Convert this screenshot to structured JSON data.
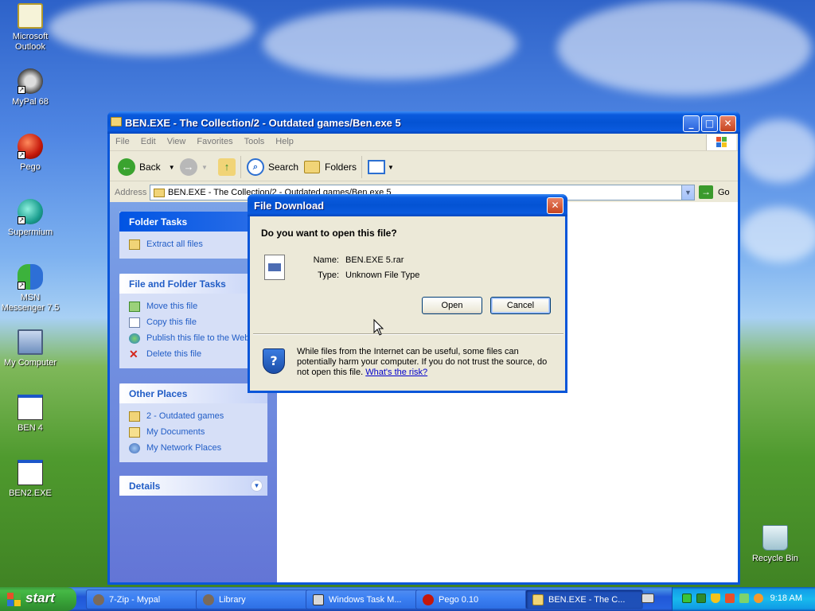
{
  "desktop": {
    "icons": [
      {
        "label": "Microsoft Outlook"
      },
      {
        "label": "MyPal 68"
      },
      {
        "label": "Pego"
      },
      {
        "label": "Supermium"
      },
      {
        "label": "MSN Messenger 7.5"
      },
      {
        "label": "My Computer"
      },
      {
        "label": "BEN 4"
      },
      {
        "label": "BEN2.EXE"
      },
      {
        "label": "Recycle Bin"
      }
    ]
  },
  "explorer": {
    "title": "BEN.EXE - The Collection/2 - Outdated games/Ben.exe 5",
    "menu": [
      "File",
      "Edit",
      "View",
      "Favorites",
      "Tools",
      "Help"
    ],
    "toolbar": {
      "back": "Back",
      "search": "Search",
      "folders": "Folders"
    },
    "address": {
      "label": "Address",
      "value": "BEN.EXE - The Collection/2 - Outdated games/Ben.exe 5",
      "go": "Go"
    },
    "folder_tasks": {
      "title": "Folder Tasks",
      "items": [
        "Extract all files"
      ]
    },
    "file_tasks": {
      "title": "File and Folder Tasks",
      "items": [
        "Move this file",
        "Copy this file",
        "Publish this file to the Web",
        "Delete this file"
      ]
    },
    "other_places": {
      "title": "Other Places",
      "items": [
        "2 - Outdated games",
        "My Documents",
        "My Network Places"
      ]
    },
    "details": {
      "title": "Details"
    }
  },
  "dialog": {
    "title": "File Download",
    "question": "Do you want to open this file?",
    "name_label": "Name:",
    "name_value": "BEN.EXE 5.rar",
    "type_label": "Type:",
    "type_value": "Unknown File Type",
    "open": "Open",
    "cancel": "Cancel",
    "warning": "While files from the Internet can be useful, some files can potentially harm your computer. If you do not trust the source, do not open this file.",
    "risk_link": "What's the risk?"
  },
  "taskbar": {
    "start": "start",
    "tasks": [
      "7-Zip - Mypal",
      "Library",
      "Windows Task M...",
      "Pego 0.10",
      "BEN.EXE - The C..."
    ],
    "clock": "9:18 AM"
  }
}
